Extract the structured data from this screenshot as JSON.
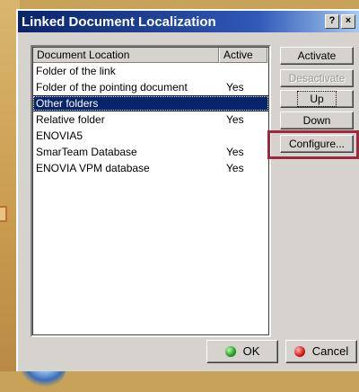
{
  "window": {
    "title": "Linked Document Localization"
  },
  "list": {
    "headers": {
      "location": "Document Location",
      "active": "Active"
    },
    "rows": [
      {
        "location": "Folder of the link",
        "active": ""
      },
      {
        "location": "Folder of the pointing document",
        "active": "Yes"
      },
      {
        "location": "Other folders",
        "active": "",
        "selected": true
      },
      {
        "location": "Relative folder",
        "active": "Yes"
      },
      {
        "location": "ENOVIA5",
        "active": ""
      },
      {
        "location": "SmarTeam Database",
        "active": "Yes"
      },
      {
        "location": "ENOVIA VPM  database",
        "active": "Yes"
      }
    ]
  },
  "buttons": {
    "activate": "Activate",
    "deactivate": "Desactivate",
    "up": "Up",
    "down": "Down",
    "configure": "Configure...",
    "ok": "OK",
    "cancel": "Cancel"
  },
  "colors": {
    "title_bar": "#0a246a",
    "selection": "#0a246a",
    "highlight": "#9c2a3c"
  }
}
